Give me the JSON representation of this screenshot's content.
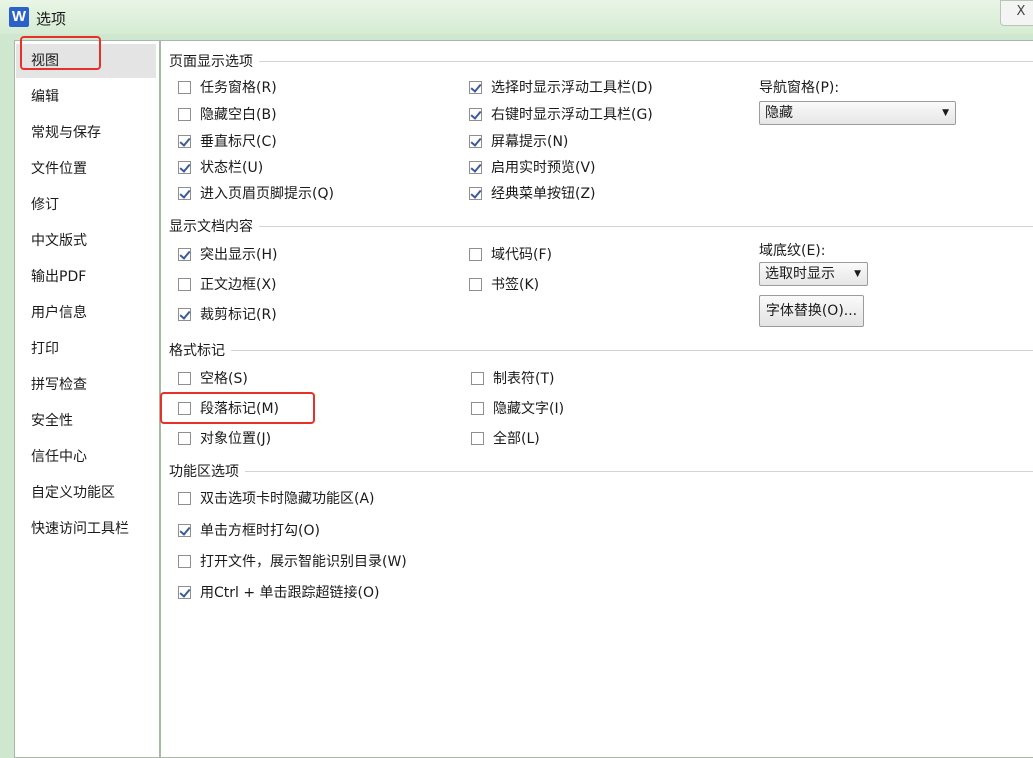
{
  "window": {
    "app_icon": "W",
    "title": "选项",
    "close_label": "X"
  },
  "sidebar": {
    "items": [
      {
        "label": "视图"
      },
      {
        "label": "编辑"
      },
      {
        "label": "常规与保存"
      },
      {
        "label": "文件位置"
      },
      {
        "label": "修订"
      },
      {
        "label": "中文版式"
      },
      {
        "label": "输出PDF"
      },
      {
        "label": "用户信息"
      },
      {
        "label": "打印"
      },
      {
        "label": "拼写检查"
      },
      {
        "label": "安全性"
      },
      {
        "label": "信任中心"
      },
      {
        "label": "自定义功能区"
      },
      {
        "label": "快速访问工具栏"
      }
    ],
    "selected": "视图"
  },
  "page_display": {
    "title": "页面显示选项",
    "options": [
      {
        "label": "任务窗格(R)",
        "checked": false
      },
      {
        "label": "隐藏空白(B)",
        "checked": false
      },
      {
        "label": "垂直标尺(C)",
        "checked": true
      },
      {
        "label": "状态栏(U)",
        "checked": true
      },
      {
        "label": "进入页眉页脚提示(Q)",
        "checked": true
      },
      {
        "label": "选择时显示浮动工具栏(D)",
        "checked": true
      },
      {
        "label": "右键时显示浮动工具栏(G)",
        "checked": true
      },
      {
        "label": "屏幕提示(N)",
        "checked": true
      },
      {
        "label": "启用实时预览(V)",
        "checked": true
      },
      {
        "label": "经典菜单按钮(Z)",
        "checked": true
      }
    ],
    "nav_pane_label": "导航窗格(P):",
    "nav_pane_value": "隐藏"
  },
  "doc_content": {
    "title": "显示文档内容",
    "options": [
      {
        "label": "突出显示(H)",
        "checked": true
      },
      {
        "label": "正文边框(X)",
        "checked": false
      },
      {
        "label": "裁剪标记(R)",
        "checked": true
      },
      {
        "label": "域代码(F)",
        "checked": false
      },
      {
        "label": "书签(K)",
        "checked": false
      }
    ],
    "field_shading_label": "域底纹(E):",
    "field_shading_value": "选取时显示",
    "font_sub_button": "字体替换(O)..."
  },
  "format_marks": {
    "title": "格式标记",
    "options": [
      {
        "label": "空格(S)",
        "checked": false
      },
      {
        "label": "段落标记(M)",
        "checked": false
      },
      {
        "label": "对象位置(J)",
        "checked": false
      },
      {
        "label": "制表符(T)",
        "checked": false
      },
      {
        "label": "隐藏文字(I)",
        "checked": false
      },
      {
        "label": "全部(L)",
        "checked": false
      }
    ]
  },
  "ribbon_options": {
    "title": "功能区选项",
    "options": [
      {
        "label": "双击选项卡时隐藏功能区(A)",
        "checked": false
      },
      {
        "label": "单击方框时打勾(O)",
        "checked": true
      },
      {
        "label": "打开文件，展示智能识别目录(W)",
        "checked": false
      },
      {
        "label": "用Ctrl + 单击跟踪超链接(O)",
        "checked": true
      }
    ]
  },
  "colors": {
    "highlight": "#e8302a",
    "background": "#cfe6cf"
  }
}
